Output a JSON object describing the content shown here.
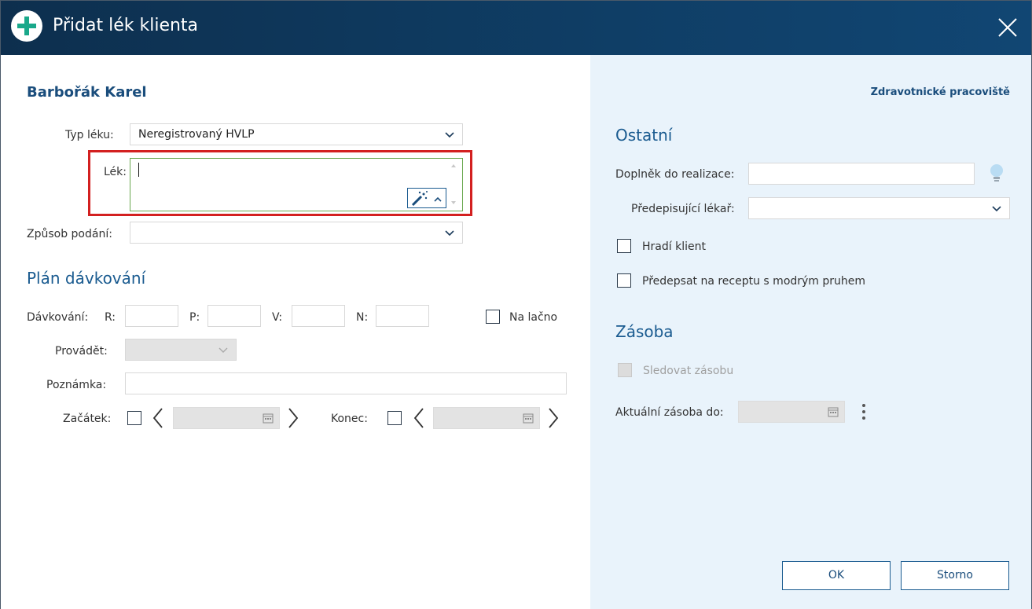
{
  "window": {
    "title": "Přidat lék klienta",
    "close_icon": "close-icon",
    "add_icon": "plus-circle-icon",
    "accent": "#0f3e66"
  },
  "patient": {
    "name": "Barbořák Karel"
  },
  "form": {
    "typ_leku_label": "Typ léku:",
    "typ_leku_value": "Neregistrovaný HVLP",
    "lek_label": "Lék:",
    "lek_value": "",
    "zpusob_podani_label": "Způsob podání:",
    "zpusob_podani_value": ""
  },
  "plan": {
    "title": "Plán dávkování",
    "davkovani_label": "Dávkování:",
    "r_label": "R:",
    "p_label": "P:",
    "v_label": "V:",
    "n_label": "N:",
    "na_lacno_label": "Na lačno",
    "provadet_label": "Provádět:",
    "poznamka_label": "Poznámka:",
    "zacatek_label": "Začátek:",
    "konec_label": "Konec:"
  },
  "right": {
    "link": "Zdravotnické pracoviště",
    "ostatni_title": "Ostatní",
    "doplnek_label": "Doplněk do realizace:",
    "predepisujici_label": "Předepisující lékař:",
    "hradi_label": "Hradí klient",
    "predepsat_label": "Předepsat na receptu s modrým pruhem",
    "zasoba_title": "Zásoba",
    "sledovat_label": "Sledovat zásobu",
    "aktualni_label": "Aktuální zásoba do:"
  },
  "buttons": {
    "ok": "OK",
    "storno": "Storno"
  },
  "colors": {
    "highlight": "#d32020",
    "right_pane_bg": "#e9f3fb",
    "heading": "#1a5b90"
  }
}
